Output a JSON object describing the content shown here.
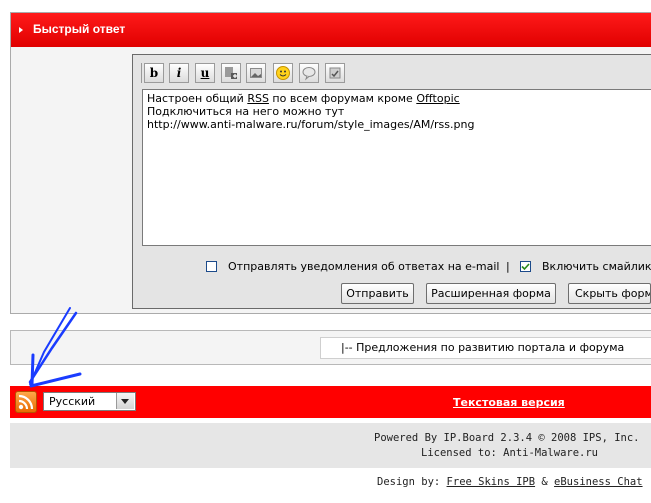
{
  "quick_reply": {
    "title": "Быстрый ответ",
    "toolbar": [
      {
        "icon": "bold-icon",
        "glyph": "b"
      },
      {
        "icon": "italic-icon",
        "glyph": "i"
      },
      {
        "icon": "underline-icon",
        "glyph": "u"
      },
      {
        "icon": "insert-link-icon",
        "glyph": ""
      },
      {
        "icon": "insert-image-icon",
        "glyph": ""
      },
      {
        "icon": "smiley-icon",
        "glyph": ""
      },
      {
        "icon": "quote-icon",
        "glyph": ""
      },
      {
        "icon": "spellcheck-icon",
        "glyph": ""
      }
    ],
    "message_lines": [
      {
        "pre": "Настроен общий ",
        "u": "RSS",
        "post": " по всем форумам кроме ",
        "u2": "Offtopic"
      },
      {
        "text": "Подключиться на него можно тут"
      },
      {
        "text": "http://www.anti-malware.ru/forum/style_images/AM/rss.png"
      }
    ],
    "options": {
      "notify_label": "Отправлять уведомления об ответах на e-mail",
      "notify_checked": false,
      "divider": "|",
      "smilies_label": "Включить смайлики",
      "smilies_checked": true
    },
    "buttons": {
      "submit": "Отправить",
      "advanced": "Расширенная форма",
      "hide": "Скрыть форму"
    }
  },
  "forum_jump": {
    "selected": "|-- Предложения по развитию портала и форума"
  },
  "footer": {
    "language": "Русский",
    "text_version_link": "Текстовая версия",
    "powered_by": "Powered By IP.Board 2.3.4 © 2008  IPS, Inc.",
    "licensed_to": "Licensed to: Anti-Malware.ru",
    "design_prefix": "Design by: ",
    "design_link1": "Free Skins IPB",
    "design_amp": " & ",
    "design_link2": "eBusiness Chat"
  },
  "colors": {
    "header_red": "#ff0000",
    "rss_orange": "#f78c1e",
    "annotation_blue": "#1a3cff"
  }
}
